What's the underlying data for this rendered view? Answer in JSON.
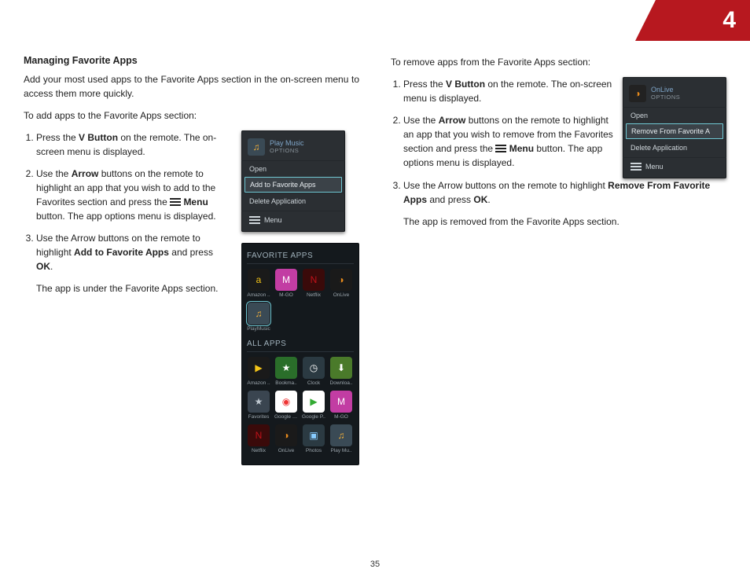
{
  "chapter_number": "4",
  "page_number": "35",
  "left": {
    "heading": "Managing Favorite Apps",
    "intro": "Add your most used apps to the Favorite Apps section in the on-screen menu to access them more quickly.",
    "lead_in": "To add apps to the Favorite Apps section:",
    "step1_a": "Press the ",
    "step1_b": "V Button",
    "step1_c": " on the remote. The on-screen menu is displayed.",
    "step2_a": "Use the ",
    "step2_b": "Arrow",
    "step2_c": " buttons on the remote to highlight an app that you wish to add to the Favorites section and press the ",
    "step2_d": "Menu",
    "step2_e": " button. The app options menu is displayed.",
    "step3_a": "Use the Arrow buttons on the remote to highlight ",
    "step3_b": "Add to Favorite Apps",
    "step3_c": " and press ",
    "step3_d": "OK",
    "step3_e": ".",
    "result": "The app is under the Favorite Apps section."
  },
  "right": {
    "lead_in": "To remove apps from the Favorite Apps section:",
    "step1_a": "Press the ",
    "step1_b": "V Button",
    "step1_c": " on the remote. The on-screen menu is displayed.",
    "step2_a": "Use the ",
    "step2_b": "Arrow",
    "step2_c": " buttons on the remote to highlight an app that you wish to remove from the Favorites section and press the ",
    "step2_d": "Menu",
    "step2_e": " button. The app options menu is displayed.",
    "step3_a": "Use the Arrow buttons on the remote to highlight ",
    "step3_b": "Remove From Favorite Apps",
    "step3_c": " and press ",
    "step3_d": "OK",
    "step3_e": ".",
    "result": "The app is removed from the Favorite Apps section."
  },
  "menu_add": {
    "title": "Play Music",
    "subtitle": "OPTIONS",
    "open": "Open",
    "selected": "Add to Favorite Apps",
    "delete": "Delete Application",
    "menu": "Menu"
  },
  "menu_remove": {
    "title": "OnLive",
    "subtitle": "OPTIONS",
    "open": "Open",
    "selected": "Remove From Favorite A",
    "delete": "Delete Application",
    "menu": "Menu"
  },
  "phone": {
    "fav_label": "FAVORITE APPS",
    "all_label": "ALL APPS",
    "fav_apps": [
      {
        "name": "Amazon ..",
        "class": "amazon",
        "glyph": "a"
      },
      {
        "name": "M-GO",
        "class": "mgo",
        "glyph": "M"
      },
      {
        "name": "Netflix",
        "class": "netflix",
        "glyph": "N"
      },
      {
        "name": "OnLive",
        "class": "onlive",
        "glyph": "◑"
      }
    ],
    "fav_apps2": [
      {
        "name": "PlayMusic",
        "class": "playmusic",
        "glyph": "♫",
        "selected": true
      }
    ],
    "all_rows": [
      [
        {
          "name": "Amazon ..",
          "class": "amazon",
          "glyph": "▶"
        },
        {
          "name": "Bookma..",
          "class": "bookmark",
          "glyph": "★"
        },
        {
          "name": "Clock",
          "class": "clock",
          "glyph": "◷"
        },
        {
          "name": "Downloa..",
          "class": "download",
          "glyph": "⬇"
        }
      ],
      [
        {
          "name": "Favorites",
          "class": "favorites",
          "glyph": "★"
        },
        {
          "name": "Google C..",
          "class": "chrome",
          "glyph": "◉"
        },
        {
          "name": "Google P..",
          "class": "play",
          "glyph": "▶"
        },
        {
          "name": "M-GO",
          "class": "mgo",
          "glyph": "M"
        }
      ],
      [
        {
          "name": "Netflix",
          "class": "netflix",
          "glyph": "N"
        },
        {
          "name": "OnLive",
          "class": "onlive",
          "glyph": "◑"
        },
        {
          "name": "Photos",
          "class": "photos",
          "glyph": "▣"
        },
        {
          "name": "Play Mu..",
          "class": "playmusic",
          "glyph": "♫"
        }
      ]
    ]
  }
}
